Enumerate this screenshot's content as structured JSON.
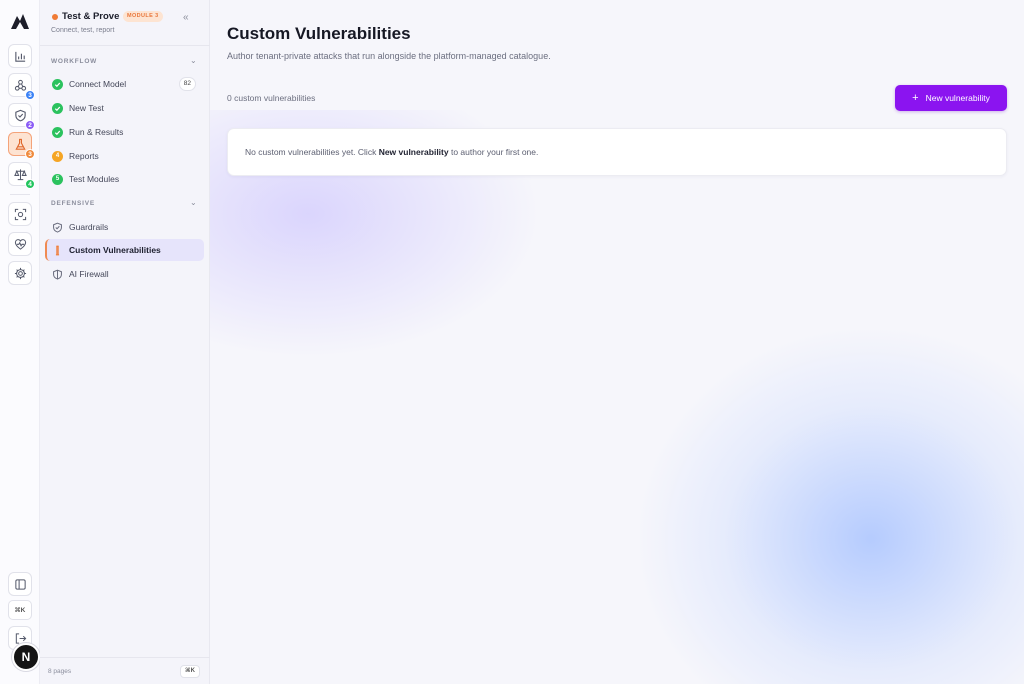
{
  "rail": {
    "items": [
      {
        "icon": "chart-icon"
      },
      {
        "icon": "network-icon",
        "badge": "3",
        "badge_color": "#3b82f6"
      },
      {
        "icon": "shield-icon",
        "badge": "2",
        "badge_color": "#8b5cf6"
      },
      {
        "icon": "flask-icon",
        "badge": "3",
        "badge_color": "#f08a3c",
        "active": true
      },
      {
        "icon": "scales-icon",
        "badge": "4",
        "badge_color": "#22c55e"
      },
      {
        "icon": "scan-icon"
      },
      {
        "icon": "heart-pulse-icon"
      },
      {
        "icon": "gear-icon"
      }
    ],
    "bottom": {
      "panel_icon": "panel-icon",
      "shortcut": "⌘K",
      "logout_icon": "logout-icon",
      "avatar_letter": "N"
    }
  },
  "sidebar": {
    "title": "Test & Prove",
    "module_badge": "MODULE 3",
    "subtitle": "Connect, test, report",
    "collapse_glyph": "«",
    "workflow": {
      "label": "WORKFLOW",
      "items": [
        {
          "label": "Connect Model",
          "status": "done",
          "count": "82"
        },
        {
          "label": "New Test",
          "status": "done"
        },
        {
          "label": "Run & Results",
          "status": "done"
        },
        {
          "label": "Reports",
          "status": "4",
          "status_color": "#f5a524"
        },
        {
          "label": "Test Modules",
          "status": "5",
          "status_color": "#2bc25e"
        }
      ]
    },
    "defensive": {
      "label": "DEFENSIVE",
      "items": [
        {
          "label": "Guardrails",
          "icon": "shield-icon"
        },
        {
          "label": "Custom Vulnerabilities",
          "icon": "flask-icon",
          "active": true
        },
        {
          "label": "AI Firewall",
          "icon": "shield-half-icon"
        }
      ]
    },
    "footer": {
      "pages": "8 pages",
      "shortcut": "⌘K"
    }
  },
  "main": {
    "title": "Custom Vulnerabilities",
    "subtitle": "Author tenant-private attacks that run alongside the platform-managed catalogue.",
    "count_text": "0 custom vulnerabilities",
    "new_button": {
      "icon": "plus-icon",
      "glyph": "+",
      "label": "New vulnerability"
    },
    "empty_state": {
      "prefix": "No custom vulnerabilities yet. Click ",
      "emphasis": "New vulnerability",
      "suffix": " to author your first one."
    }
  },
  "colors": {
    "accent": "#8b14f0",
    "module_accent": "#f07b35",
    "success": "#2bc25e"
  }
}
